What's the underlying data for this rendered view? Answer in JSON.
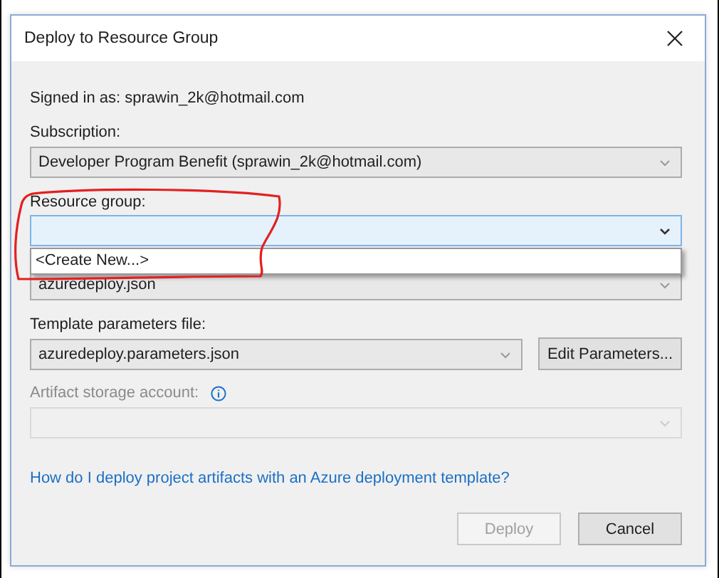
{
  "dialog": {
    "title": "Deploy to Resource Group"
  },
  "signed_in": "Signed in as: sprawin_2k@hotmail.com",
  "subscription": {
    "label": "Subscription:",
    "value": "Developer Program Benefit (sprawin_2k@hotmail.com)"
  },
  "resource_group": {
    "label": "Resource group:",
    "focused": true,
    "expanded": true,
    "options": [
      {
        "text": "<Create New...>",
        "selected": false
      }
    ]
  },
  "template_file": {
    "value": "azuredeploy.json"
  },
  "template_parameters_file": {
    "label": "Template parameters file:",
    "value": "azuredeploy.parameters.json",
    "button": "Edit Parameters..."
  },
  "artifact_storage_account": {
    "label": "Artifact storage account:",
    "disabled": true
  },
  "help_link": "How do I deploy project artifacts with an Azure deployment template?",
  "buttons": [
    {
      "label": "Deploy",
      "disabled": true
    },
    {
      "label": "Cancel",
      "disabled": false
    }
  ],
  "annotation": {
    "kind": "freehand-outline"
  }
}
